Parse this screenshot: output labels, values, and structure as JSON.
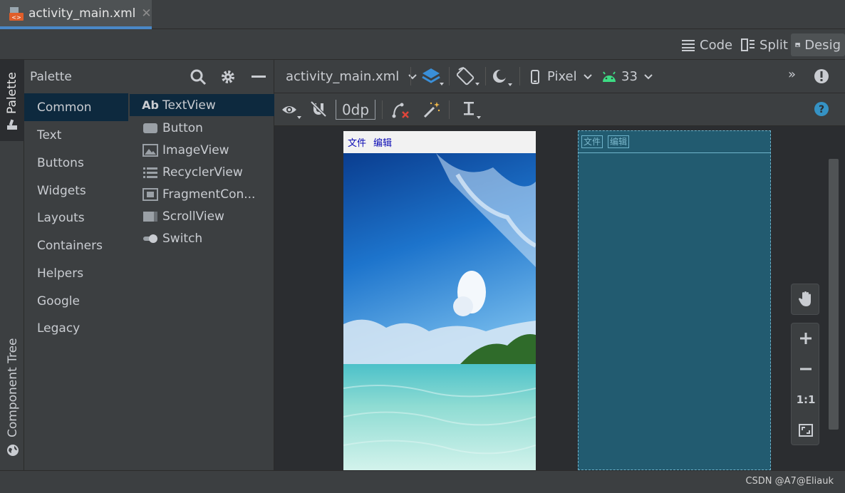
{
  "tab": {
    "title": "activity_main.xml",
    "close": "✕"
  },
  "view_modes": {
    "code": "Code",
    "split": "Split",
    "design": "Desig"
  },
  "left_strip": {
    "palette": "Palette",
    "component_tree": "Component Tree"
  },
  "palette": {
    "title": "Palette",
    "categories": [
      "Common",
      "Text",
      "Buttons",
      "Widgets",
      "Layouts",
      "Containers",
      "Helpers",
      "Google",
      "Legacy"
    ],
    "selected_category": "Common",
    "components": [
      {
        "icon": "textview-icon",
        "label": "TextView",
        "glyph": "Ab"
      },
      {
        "icon": "button-icon",
        "label": "Button"
      },
      {
        "icon": "imageview-icon",
        "label": "ImageView"
      },
      {
        "icon": "recyclerview-icon",
        "label": "RecyclerView"
      },
      {
        "icon": "fragmentcontainer-icon",
        "label": "FragmentCon..."
      },
      {
        "icon": "scrollview-icon",
        "label": "ScrollView"
      },
      {
        "icon": "switch-icon",
        "label": "Switch"
      }
    ]
  },
  "toolbar": {
    "file": "activity_main.xml",
    "device": "Pixel",
    "api": "33",
    "margin": "0dp",
    "overflow": "»"
  },
  "preview": {
    "menu_items": [
      "文件",
      "编辑"
    ]
  },
  "zoom": {
    "ratio": "1:1"
  },
  "status": {
    "watermark": "CSDN @A7@Eliauk"
  },
  "colors": {
    "accent": "#4a88c7",
    "selection": "#0d293e",
    "blueprint": "#225b70",
    "android": "#3ddc84",
    "help": "#3592c4"
  }
}
